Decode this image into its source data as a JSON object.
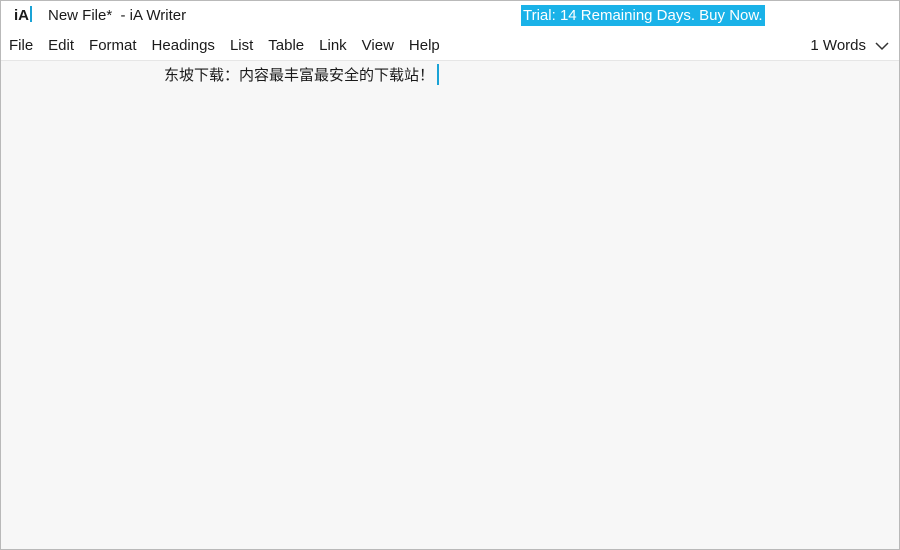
{
  "titlebar": {
    "logo": "iA",
    "title": "New File*  - iA Writer",
    "trial_banner": "Trial: 14 Remaining Days. Buy Now."
  },
  "menubar": {
    "items": [
      "File",
      "Edit",
      "Format",
      "Headings",
      "List",
      "Table",
      "Link",
      "View",
      "Help"
    ],
    "word_count": "1 Words",
    "dropdown_icon": "chevron-down-icon"
  },
  "editor": {
    "content": "东坡下载：内容最丰富最安全的下载站！"
  },
  "colors": {
    "accent": "#1ab2e8",
    "cursor": "#1aa3d6",
    "background": "#f7f7f7",
    "chrome": "#ffffff"
  }
}
